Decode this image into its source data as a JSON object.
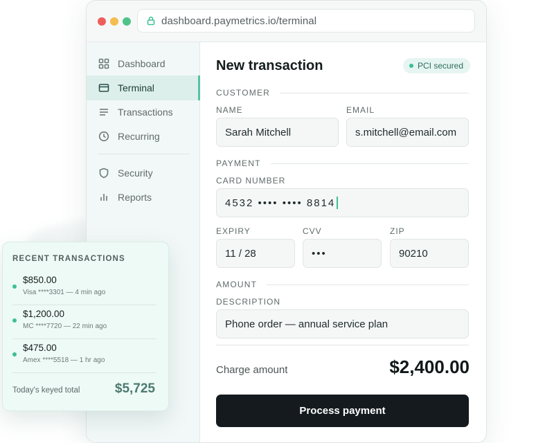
{
  "browser": {
    "url": "dashboard.paymetrics.io/terminal",
    "traffic_lights": [
      "#ee5f5b",
      "#f4bd4f",
      "#4fc28a"
    ]
  },
  "sidebar": {
    "items": [
      {
        "label": "Dashboard",
        "icon": "grid-icon",
        "active": false
      },
      {
        "label": "Terminal",
        "icon": "card-icon",
        "active": true
      },
      {
        "label": "Transactions",
        "icon": "list-icon",
        "active": false
      },
      {
        "label": "Recurring",
        "icon": "clock-icon",
        "active": false
      },
      {
        "label": "Security",
        "icon": "shield-icon",
        "active": false
      },
      {
        "label": "Reports",
        "icon": "bar-chart-icon",
        "active": false
      }
    ]
  },
  "form": {
    "title": "New transaction",
    "badge": "PCI secured",
    "customer": {
      "section_label": "CUSTOMER",
      "name_label": "NAME",
      "name_value": "Sarah Mitchell",
      "email_label": "EMAIL",
      "email_value": "s.mitchell@email.com"
    },
    "payment": {
      "section_label": "PAYMENT",
      "card_label": "CARD NUMBER",
      "card_value": "4532 •••• •••• 8814",
      "expiry_label": "EXPIRY",
      "expiry_value": "11 / 28",
      "cvv_label": "CVV",
      "cvv_value": "•••",
      "zip_label": "ZIP",
      "zip_value": "90210"
    },
    "amount": {
      "section_label": "AMOUNT",
      "description_label": "DESCRIPTION",
      "description_value": "Phone order — annual service plan"
    },
    "charge_label": "Charge amount",
    "charge_amount": "$2,400.00",
    "submit_label": "Process payment"
  },
  "recent": {
    "title": "RECENT TRANSACTIONS",
    "transactions": [
      {
        "amount": "$850.00",
        "meta": "Visa ****3301 — 4 min ago"
      },
      {
        "amount": "$1,200.00",
        "meta": "MC ****7720 — 22 min ago"
      },
      {
        "amount": "$475.00",
        "meta": "Amex ****5518 — 1 hr ago"
      }
    ],
    "total_label": "Today's keyed total",
    "total_value": "$5,725"
  },
  "colors": {
    "accent": "#3cbf93",
    "primary_button": "#141a1e",
    "active_nav_bg": "#dcefeb"
  }
}
